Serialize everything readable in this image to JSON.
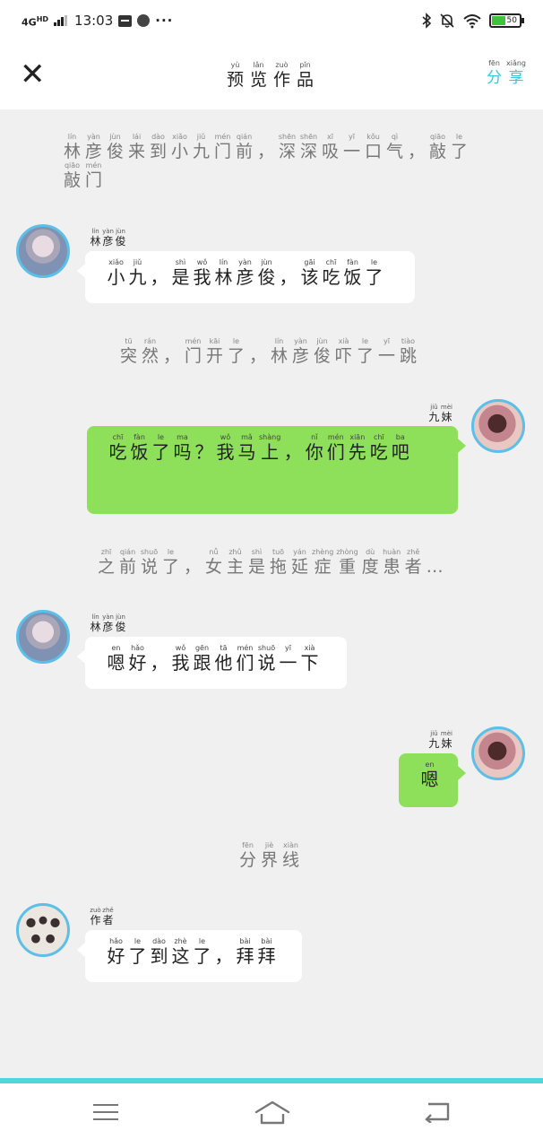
{
  "status_bar": {
    "network": "4G",
    "network_sub": "HD",
    "time": "13:03",
    "battery": "50"
  },
  "header": {
    "title": [
      [
        "yù",
        "预"
      ],
      [
        "lǎn",
        "览"
      ],
      [
        "zuò",
        "作"
      ],
      [
        "pǐn",
        "品"
      ]
    ],
    "share": [
      [
        "fēn",
        "分"
      ],
      [
        "xiǎng",
        "享"
      ]
    ]
  },
  "messages": [
    {
      "type": "narration",
      "chars": [
        [
          "lín",
          "林"
        ],
        [
          "yàn",
          "彦"
        ],
        [
          "jùn",
          "俊"
        ],
        [
          "lái",
          "来"
        ],
        [
          "dào",
          "到"
        ],
        [
          "xiǎo",
          "小"
        ],
        [
          "jiǔ",
          "九"
        ],
        [
          "mén",
          "门"
        ],
        [
          "qián",
          "前"
        ],
        [
          "",
          "，"
        ],
        [
          "shēn",
          "深"
        ],
        [
          "shēn",
          "深"
        ],
        [
          "xī",
          "吸"
        ],
        [
          "yī",
          "一"
        ],
        [
          "kǒu",
          "口"
        ],
        [
          "qì",
          "气"
        ],
        [
          "",
          "，"
        ],
        [
          "qiāo",
          "敲"
        ],
        [
          "le",
          "了"
        ],
        [
          "qiāo",
          "敲"
        ],
        [
          "mén",
          "门"
        ]
      ]
    },
    {
      "type": "left",
      "avatar": "boy-avatar",
      "speaker": [
        [
          "lín",
          "林"
        ],
        [
          "yàn",
          "彦"
        ],
        [
          "jùn",
          "俊"
        ]
      ],
      "chars": [
        [
          "xiǎo",
          "小"
        ],
        [
          "jiǔ",
          "九"
        ],
        [
          "",
          "，"
        ],
        [
          "shì",
          "是"
        ],
        [
          "wǒ",
          "我"
        ],
        [
          "lín",
          "林"
        ],
        [
          "yàn",
          "彦"
        ],
        [
          "jùn",
          "俊"
        ],
        [
          "",
          "，"
        ],
        [
          "gāi",
          "该"
        ],
        [
          "chī",
          "吃"
        ],
        [
          "fàn",
          "饭"
        ],
        [
          "le",
          "了"
        ]
      ]
    },
    {
      "type": "narration",
      "chars": [
        [
          "tū",
          "突"
        ],
        [
          "rán",
          "然"
        ],
        [
          "",
          "，"
        ],
        [
          "mén",
          "门"
        ],
        [
          "kāi",
          "开"
        ],
        [
          "le",
          "了"
        ],
        [
          "",
          "，"
        ],
        [
          "lín",
          "林"
        ],
        [
          "yàn",
          "彦"
        ],
        [
          "jùn",
          "俊"
        ],
        [
          "xià",
          "吓"
        ],
        [
          "le",
          "了"
        ],
        [
          "yī",
          "一"
        ],
        [
          "tiào",
          "跳"
        ]
      ]
    },
    {
      "type": "right",
      "avatar": "girl-avatar",
      "speaker": [
        [
          "jiǔ",
          "九"
        ],
        [
          "mèi",
          "妹"
        ]
      ],
      "chars": [
        [
          "chī",
          "吃"
        ],
        [
          "fàn",
          "饭"
        ],
        [
          "le",
          "了"
        ],
        [
          "ma",
          "吗"
        ],
        [
          "",
          "？"
        ],
        [
          "wǒ",
          "我"
        ],
        [
          "mǎ",
          "马"
        ],
        [
          "shàng",
          "上"
        ],
        [
          "",
          "，"
        ],
        [
          "nǐ",
          "你"
        ],
        [
          "mén",
          "们"
        ],
        [
          "xiān",
          "先"
        ],
        [
          "chī",
          "吃"
        ],
        [
          "ba",
          "吧"
        ]
      ]
    },
    {
      "type": "narration",
      "chars": [
        [
          "zhī",
          "之"
        ],
        [
          "qián",
          "前"
        ],
        [
          "shuō",
          "说"
        ],
        [
          "le",
          "了"
        ],
        [
          "",
          "，"
        ],
        [
          "nǚ",
          "女"
        ],
        [
          "zhǔ",
          "主"
        ],
        [
          "shì",
          "是"
        ],
        [
          "tuō",
          "拖"
        ],
        [
          "yán",
          "延"
        ],
        [
          "zhèng",
          "症"
        ],
        [
          "zhòng",
          "重"
        ],
        [
          "dù",
          "度"
        ],
        [
          "huàn",
          "患"
        ],
        [
          "zhě",
          "者"
        ],
        [
          "",
          "…"
        ]
      ]
    },
    {
      "type": "left",
      "avatar": "boy-avatar",
      "speaker": [
        [
          "lín",
          "林"
        ],
        [
          "yàn",
          "彦"
        ],
        [
          "jùn",
          "俊"
        ]
      ],
      "chars": [
        [
          "en",
          "嗯"
        ],
        [
          "hǎo",
          "好"
        ],
        [
          "",
          "，"
        ],
        [
          "wǒ",
          "我"
        ],
        [
          "gēn",
          "跟"
        ],
        [
          "tā",
          "他"
        ],
        [
          "mén",
          "们"
        ],
        [
          "shuō",
          "说"
        ],
        [
          "yī",
          "一"
        ],
        [
          "xià",
          "下"
        ]
      ]
    },
    {
      "type": "right",
      "avatar": "girl-avatar",
      "speaker": [
        [
          "jiǔ",
          "九"
        ],
        [
          "mèi",
          "妹"
        ]
      ],
      "chars": [
        [
          "en",
          "嗯"
        ]
      ]
    },
    {
      "type": "narration",
      "chars": [
        [
          "fēn",
          "分"
        ],
        [
          "jiè",
          "界"
        ],
        [
          "xiàn",
          "线"
        ]
      ]
    },
    {
      "type": "left",
      "avatar": "group-avatar",
      "speaker": [
        [
          "zuò",
          "作"
        ],
        [
          "zhě",
          "者"
        ]
      ],
      "chars": [
        [
          "hǎo",
          "好"
        ],
        [
          "le",
          "了"
        ],
        [
          "dào",
          "到"
        ],
        [
          "zhè",
          "这"
        ],
        [
          "le",
          "了"
        ],
        [
          "",
          "，"
        ],
        [
          "bài",
          "拜"
        ],
        [
          "bài",
          "拜"
        ]
      ]
    }
  ],
  "colors": {
    "accent": "#3ec6d3",
    "bubble_right": "#8ee05a",
    "avatar_border": "#5bbfe8",
    "background": "#f0f0f0"
  }
}
